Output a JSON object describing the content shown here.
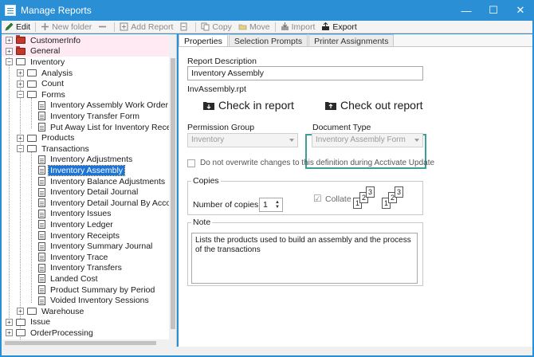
{
  "window": {
    "title": "Manage Reports",
    "controls": [
      "—",
      "☐",
      "✕"
    ]
  },
  "toolbar": {
    "edit": "Edit",
    "new_folder": "New folder",
    "add_report": "Add Report",
    "copy": "Copy",
    "move": "Move",
    "import": "Import",
    "export": "Export"
  },
  "tree": {
    "items": [
      {
        "label": "CustomerInfo",
        "level": 0,
        "expander": "+",
        "icon": "folder-closed"
      },
      {
        "label": "General",
        "level": 0,
        "expander": "+",
        "icon": "folder-closed"
      },
      {
        "label": "Inventory",
        "level": 0,
        "expander": "−",
        "icon": "folder-open"
      },
      {
        "label": "Analysis",
        "level": 1,
        "expander": "+",
        "icon": "folder-open"
      },
      {
        "label": "Count",
        "level": 1,
        "expander": "+",
        "icon": "folder-open"
      },
      {
        "label": "Forms",
        "level": 1,
        "expander": "−",
        "icon": "folder-open"
      },
      {
        "label": "Inventory Assembly Work Order",
        "level": 2,
        "expander": "",
        "icon": "doc"
      },
      {
        "label": "Inventory Transfer Form",
        "level": 2,
        "expander": "",
        "icon": "doc"
      },
      {
        "label": "Put Away List for Inventory Receipts",
        "level": 2,
        "expander": "",
        "icon": "doc"
      },
      {
        "label": "Products",
        "level": 1,
        "expander": "+",
        "icon": "folder-open"
      },
      {
        "label": "Transactions",
        "level": 1,
        "expander": "−",
        "icon": "folder-open"
      },
      {
        "label": "Inventory Adjustments",
        "level": 2,
        "expander": "",
        "icon": "doc"
      },
      {
        "label": "Inventory Assembly",
        "level": 2,
        "expander": "",
        "icon": "doc"
      },
      {
        "label": "Inventory Balance Adjustments",
        "level": 2,
        "expander": "",
        "icon": "doc"
      },
      {
        "label": "Inventory Detail Journal",
        "level": 2,
        "expander": "",
        "icon": "doc"
      },
      {
        "label": "Inventory Detail Journal By Account",
        "level": 2,
        "expander": "",
        "icon": "doc"
      },
      {
        "label": "Inventory Issues",
        "level": 2,
        "expander": "",
        "icon": "doc"
      },
      {
        "label": "Inventory Ledger",
        "level": 2,
        "expander": "",
        "icon": "doc"
      },
      {
        "label": "Inventory Receipts",
        "level": 2,
        "expander": "",
        "icon": "doc"
      },
      {
        "label": "Inventory Summary Journal",
        "level": 2,
        "expander": "",
        "icon": "doc"
      },
      {
        "label": "Inventory Trace",
        "level": 2,
        "expander": "",
        "icon": "doc"
      },
      {
        "label": "Inventory Transfers",
        "level": 2,
        "expander": "",
        "icon": "doc"
      },
      {
        "label": "Landed Cost",
        "level": 2,
        "expander": "",
        "icon": "doc"
      },
      {
        "label": "Product Summary by Period",
        "level": 2,
        "expander": "",
        "icon": "doc"
      },
      {
        "label": "Voided Inventory Sessions",
        "level": 2,
        "expander": "",
        "icon": "doc"
      },
      {
        "label": "Warehouse",
        "level": 1,
        "expander": "+",
        "icon": "folder-open"
      },
      {
        "label": "Issue",
        "level": 0,
        "expander": "+",
        "icon": "folder-open"
      },
      {
        "label": "OrderProcessing",
        "level": 0,
        "expander": "+",
        "icon": "folder-open"
      }
    ],
    "selected_label": "Inventory Assembly"
  },
  "tabs": [
    "Properties",
    "Selection Prompts",
    "Printer Assignments"
  ],
  "properties": {
    "report_description_label": "Report Description",
    "report_description_value": "Inventory Assembly",
    "file_name": "InvAssembly.rpt",
    "check_in": "Check in report",
    "check_out": "Check out report",
    "permission_group_label": "Permission Group",
    "permission_group_value": "Inventory",
    "document_type_label": "Document Type",
    "document_type_value": "Inventory Assembly Form",
    "overwrite_checkbox_label": "Do not overwrite changes to this definition during Acctivate Update",
    "copies_group": "Copies",
    "copies_label": "Number of copies:",
    "copies_value": "1",
    "collate_label": "Collate",
    "note_group": "Note",
    "note_text": "Lists the products used to build an assembly and the process of the transactions"
  },
  "colors": {
    "titlebar": "#2b8fd6",
    "selection": "#1e73d6",
    "doc_type_frame": "#3a9f96"
  }
}
